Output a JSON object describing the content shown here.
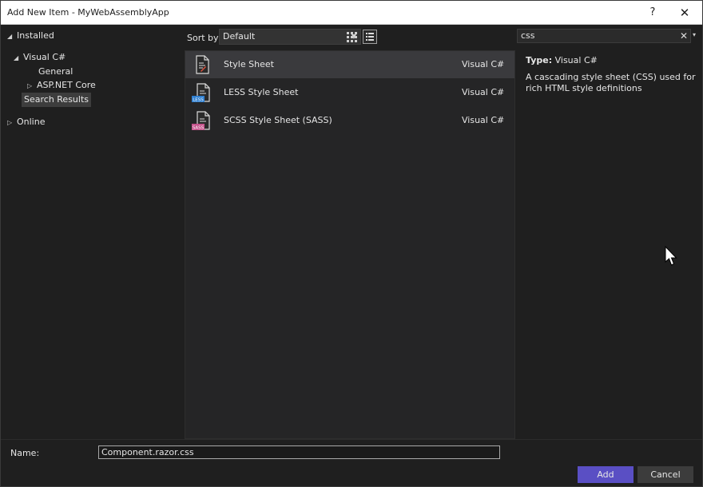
{
  "window": {
    "title": "Add New Item - MyWebAssemblyApp",
    "help_label": "?",
    "close_label": "✕"
  },
  "tree": {
    "installed": "Installed",
    "visual_csharp": "Visual C#",
    "general": "General",
    "aspnet_core": "ASP.NET Core",
    "search_results": "Search Results",
    "online": "Online"
  },
  "toolbar": {
    "sort_label": "Sort by:",
    "sort_value": "Default",
    "view_grid_icon": "grid-view-icon",
    "view_list_icon": "list-view-icon"
  },
  "templates": [
    {
      "name": "Style Sheet",
      "language": "Visual C#",
      "icon": "css-file-icon"
    },
    {
      "name": "LESS Style Sheet",
      "language": "Visual C#",
      "icon": "less-file-icon",
      "badge": "LESS"
    },
    {
      "name": "SCSS Style Sheet (SASS)",
      "language": "Visual C#",
      "icon": "scss-file-icon",
      "badge": "SASS"
    }
  ],
  "search": {
    "value": "css",
    "clear_label": "✕",
    "dropdown_label": "▾"
  },
  "details": {
    "type_key": "Type:",
    "type_value": "Visual C#",
    "description": "A cascading style sheet (CSS) used for rich HTML style definitions"
  },
  "footer": {
    "name_label": "Name:",
    "name_value": "Component.razor.css",
    "add_label": "Add",
    "cancel_label": "Cancel"
  },
  "colors": {
    "accent": "#5a4fc4",
    "less_badge": "#2f7fd0",
    "sass_badge": "#c6538c"
  }
}
